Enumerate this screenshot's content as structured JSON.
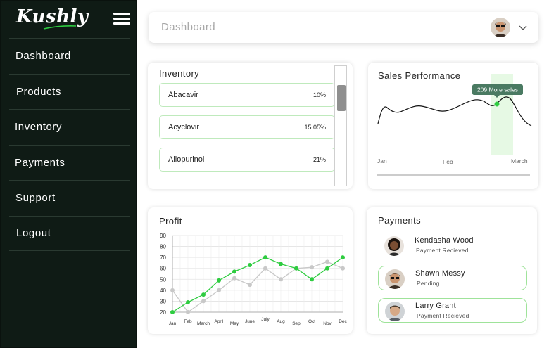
{
  "app": {
    "logo": "Kushly"
  },
  "sidebar": {
    "items": [
      {
        "label": "Dashboard"
      },
      {
        "label": "Products"
      },
      {
        "label": "Inventory"
      },
      {
        "label": "Payments"
      },
      {
        "label": "Support"
      },
      {
        "label": "Logout"
      }
    ]
  },
  "header": {
    "title": "Dashboard"
  },
  "inventory": {
    "title": "Inventory",
    "items": [
      {
        "name": "Abacavir",
        "percent": "10%"
      },
      {
        "name": "Acyclovir",
        "percent": "15.05%"
      },
      {
        "name": "Allopurinol",
        "percent": "21%"
      }
    ]
  },
  "sales": {
    "title": "Sales Performance",
    "tooltip": "209 More sales",
    "x_labels": [
      "Jan",
      "Feb",
      "March"
    ]
  },
  "profit": {
    "title": "Profit"
  },
  "payments": {
    "title": "Payments",
    "items": [
      {
        "name": "Kendasha Wood",
        "status": "Payment Recieved"
      },
      {
        "name": "Shawn Messy",
        "status": "Pending"
      },
      {
        "name": "Larry Grant",
        "status": "Payment Recieved"
      }
    ]
  },
  "colors": {
    "sidebar_bg": "#0f1b15",
    "accent": "#2ecc40",
    "highlight": "#e6f9e4",
    "secondary_series": "#c8c8c8"
  },
  "chart_data": [
    {
      "type": "line",
      "title": "Sales Performance",
      "x": [
        "Jan",
        "Feb",
        "March"
      ],
      "series": [],
      "annotations": [
        "209 More sales"
      ]
    },
    {
      "type": "line",
      "title": "Profit",
      "categories": [
        "Jan",
        "Feb",
        "March",
        "April",
        "May",
        "June",
        "July",
        "Aug",
        "Sep",
        "Oct",
        "Nov",
        "Dec"
      ],
      "series": [
        {
          "values": [
            20,
            29,
            36,
            49,
            57,
            63,
            70,
            64,
            60,
            50,
            60,
            70
          ],
          "color": "#2ecc40"
        },
        {
          "values": [
            40,
            20,
            30,
            40,
            51,
            45,
            60,
            50,
            60,
            61,
            66,
            60
          ],
          "color": "#c8c8c8"
        }
      ],
      "yticks": [
        20,
        30,
        40,
        50,
        60,
        70,
        80,
        90
      ],
      "ylim": [
        20,
        90
      ],
      "grid": true
    }
  ]
}
